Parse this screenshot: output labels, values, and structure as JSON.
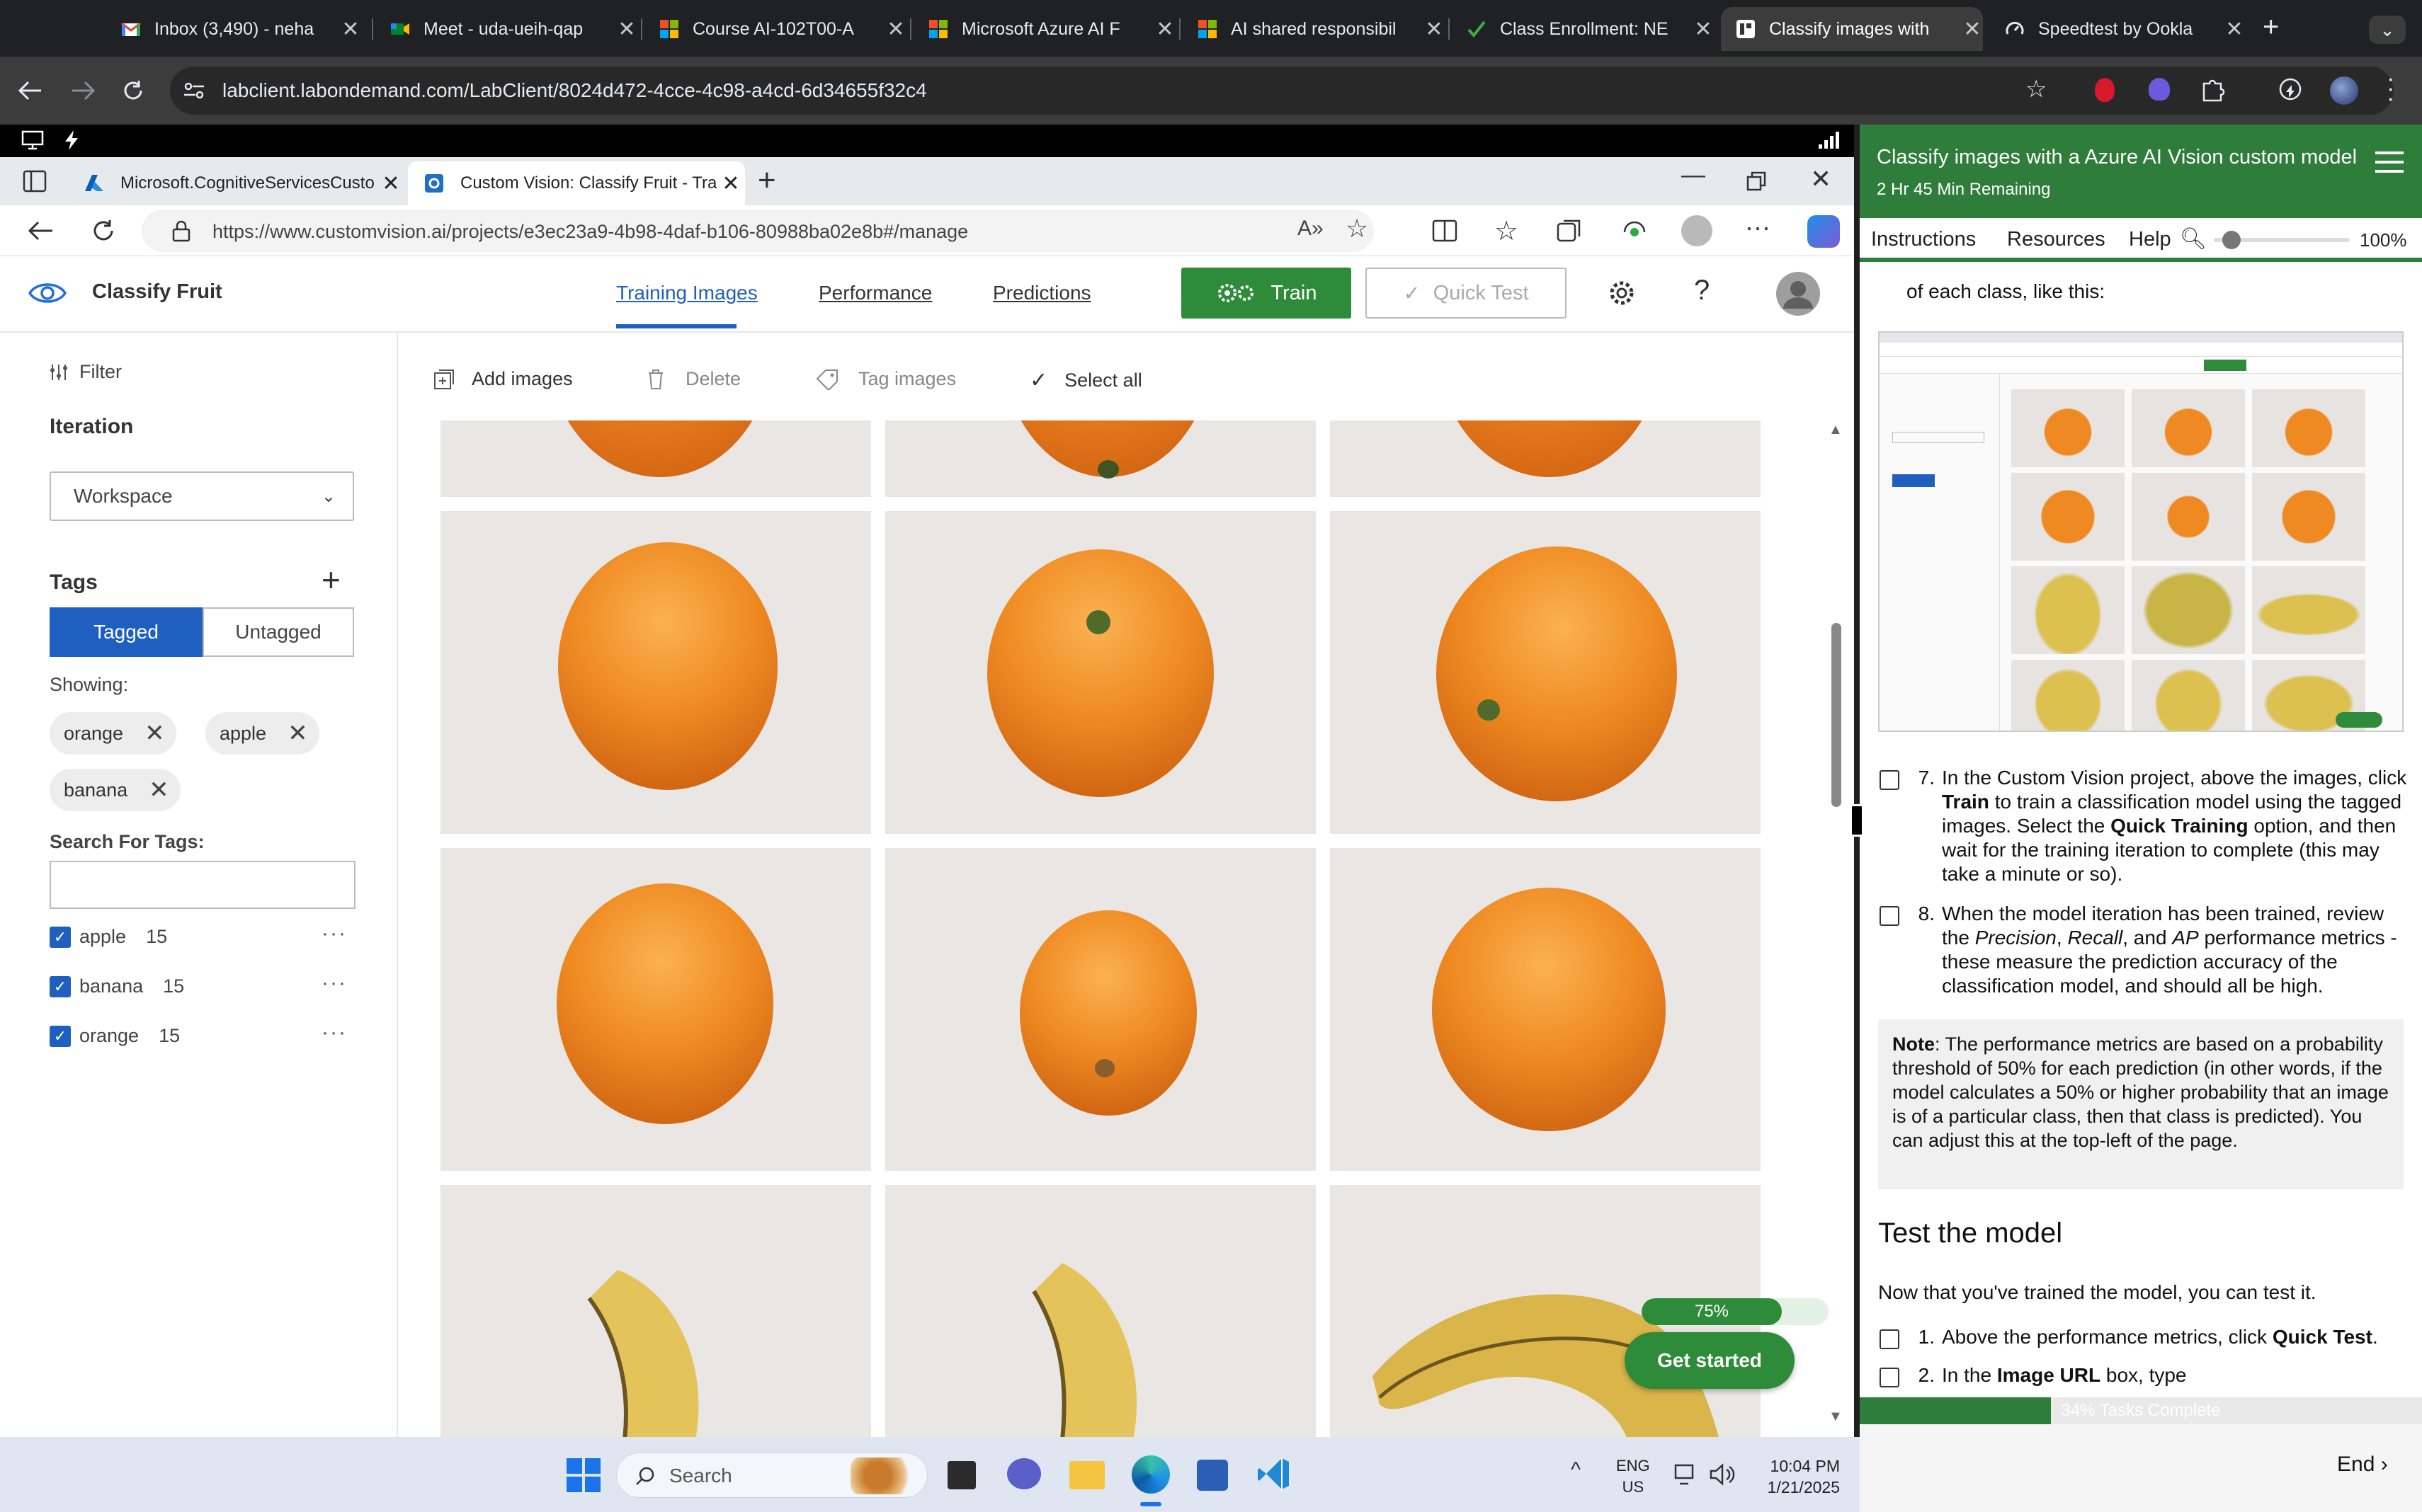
{
  "browser_tabs": [
    {
      "title": "Inbox (3,490) - neha",
      "icon": "gmail-icon"
    },
    {
      "title": "Meet - uda-ueih-qap",
      "icon": "meet-icon"
    },
    {
      "title": "Course AI-102T00-A",
      "icon": "microsoft-icon"
    },
    {
      "title": "Microsoft Azure AI F",
      "icon": "microsoft-icon"
    },
    {
      "title": "AI shared responsibil",
      "icon": "microsoft-icon"
    },
    {
      "title": "Class Enrollment: NE",
      "icon": "checkmark-icon"
    },
    {
      "title": "Classify images with",
      "icon": "lab-icon"
    },
    {
      "title": "Speedtest by Ookla",
      "icon": "speedtest-icon"
    }
  ],
  "address_url": "labclient.labondemand.com/LabClient/8024d472-4cce-4c98-a4cd-6d34655f32c4",
  "edge": {
    "tabs": [
      {
        "title": "Microsoft.CognitiveServicesCusto"
      },
      {
        "title": "Custom Vision: Classify Fruit - Tra"
      }
    ],
    "url": "https://www.customvision.ai/projects/e3ec23a9-4b98-4daf-b106-80988ba02e8b#/manage"
  },
  "cv": {
    "project": "Classify Fruit",
    "nav": {
      "training": "Training Images",
      "performance": "Performance",
      "predictions": "Predictions"
    },
    "train": "Train",
    "quick_test": "Quick Test",
    "filter": "Filter",
    "iteration_label": "Iteration",
    "iteration_value": "Workspace",
    "tags_label": "Tags",
    "tagged": "Tagged",
    "untagged": "Untagged",
    "showing": "Showing:",
    "chips": [
      "orange",
      "apple",
      "banana"
    ],
    "search_tags_label": "Search For Tags:",
    "tag_list": [
      {
        "name": "apple",
        "count": "15"
      },
      {
        "name": "banana",
        "count": "15"
      },
      {
        "name": "orange",
        "count": "15"
      }
    ],
    "toolbar": {
      "add": "Add images",
      "delete": "Delete",
      "tag": "Tag images",
      "select_all": "Select all"
    },
    "progress_label": "75%",
    "progress_value": 0.75,
    "get_started": "Get started"
  },
  "lab": {
    "title": "Classify images with a Azure AI Vision custom model",
    "remaining": "2 Hr 45 Min Remaining",
    "tabs": {
      "instructions": "Instructions",
      "resources": "Resources",
      "help": "Help"
    },
    "zoom": "100%",
    "top_text": "of each class, like this:",
    "step7_num": "7.",
    "step7": [
      "In the Custom Vision project, above the images, click ",
      "Train",
      " to train a classification model using the tagged images. Select the ",
      "Quick Training",
      " option, and then wait for the training iteration to complete (this may take a minute or so)."
    ],
    "step8_num": "8.",
    "step8": [
      "When the model iteration has been trained, review the ",
      "Precision",
      ", ",
      "Recall",
      ", and ",
      "AP",
      " performance metrics - these measure the prediction accuracy of the classification model, and should all be high."
    ],
    "note_label": "Note",
    "note_text": ": The performance metrics are based on a probability threshold of 50% for each prediction (in other words, if the model calculates a 50% or higher probability that an image is of a particular class, then that class is predicted). You can adjust this at the top-left of the page.",
    "test_heading": "Test the model",
    "test_intro": "Now that you've trained the model, you can test it.",
    "test1_num": "1.",
    "test1": [
      "Above the performance metrics, click ",
      "Quick Test",
      "."
    ],
    "test2_num": "2.",
    "test2": [
      "In the ",
      "Image URL",
      " box, type"
    ],
    "tasks_label": "34% Tasks Complete",
    "tasks_value": 0.34,
    "end": "End"
  },
  "taskbar": {
    "search": "Search",
    "lang1": "ENG",
    "lang2": "US",
    "time": "10:04 PM",
    "date": "1/21/2025"
  }
}
